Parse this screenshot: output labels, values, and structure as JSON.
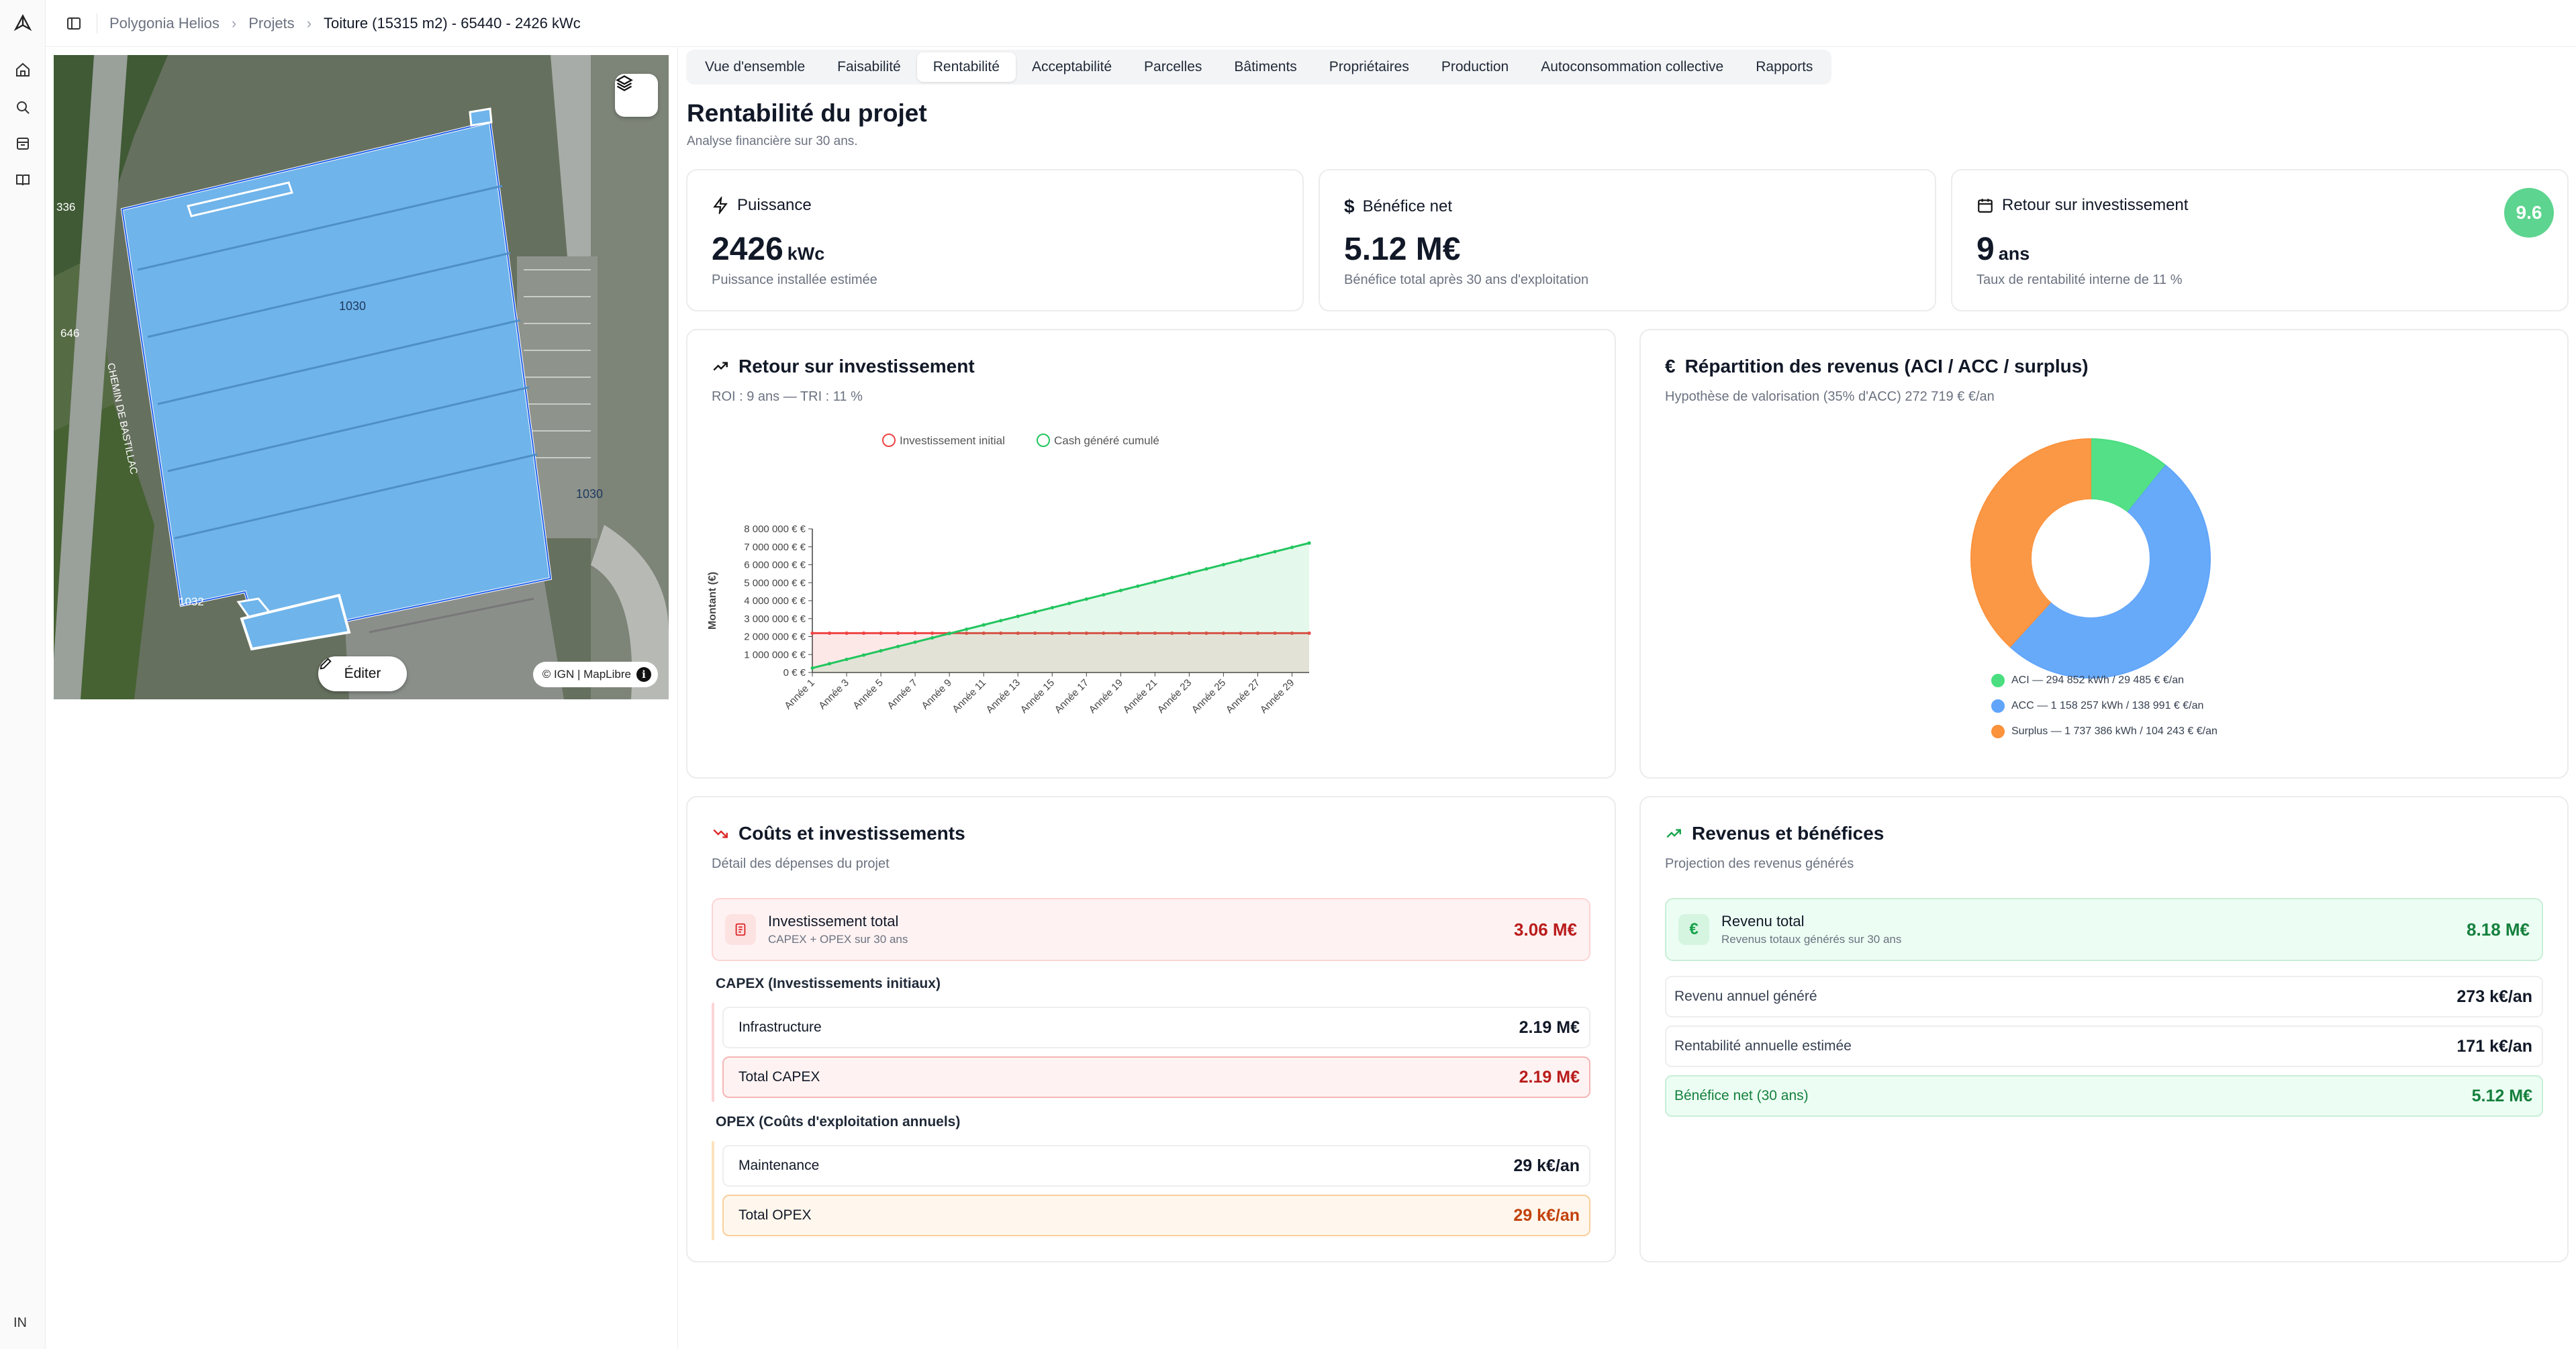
{
  "rail": {
    "user_initials": "IN"
  },
  "breadcrumb": [
    "Polygonia Helios",
    "Projets",
    "Toiture (15315 m2) - 65440 - 2426 kWc"
  ],
  "map": {
    "edit_label": "Éditer",
    "attribution": "© IGN | MapLibre",
    "labels": [
      "1030",
      "1030",
      "336",
      "646",
      "CHEMIN DE BASTILLAC",
      "1032"
    ]
  },
  "tabs": [
    {
      "label": "Vue d'ensemble",
      "active": false
    },
    {
      "label": "Faisabilité",
      "active": false
    },
    {
      "label": "Rentabilité",
      "active": true
    },
    {
      "label": "Acceptabilité",
      "active": false
    },
    {
      "label": "Parcelles",
      "active": false
    },
    {
      "label": "Bâtiments",
      "active": false
    },
    {
      "label": "Propriétaires",
      "active": false
    },
    {
      "label": "Production",
      "active": false
    },
    {
      "label": "Autoconsommation collective",
      "active": false
    },
    {
      "label": "Rapports",
      "active": false
    }
  ],
  "page": {
    "title": "Rentabilité du projet",
    "subtitle": "Analyse financière sur 30 ans."
  },
  "kpis": {
    "puissance": {
      "title": "Puissance",
      "value": "2426",
      "unit": "kWc",
      "desc": "Puissance installée estimée"
    },
    "benefice": {
      "title": "Bénéfice net",
      "value": "5.12 M€",
      "desc": "Bénéfice total après 30 ans d'exploitation"
    },
    "retour": {
      "title": "Retour sur investissement",
      "value": "9",
      "unit": "ans",
      "desc": "Taux de rentabilité interne de 11 %",
      "score": "9.6"
    }
  },
  "roi_card": {
    "title": "Retour sur investissement",
    "subtitle": "ROI : 9 ans — TRI : 11 %"
  },
  "revenue_card": {
    "title": "Répartition des revenus (ACI / ACC / surplus)",
    "subtitle": "Hypothèse de valorisation (35% d'ACC) 272 719 € €/an"
  },
  "chart_data": [
    {
      "type": "line",
      "ylabel": "Montant (€)",
      "ylim": [
        0,
        8000000
      ],
      "yticks": [
        "0 € €",
        "1 000 000 € €",
        "2 000 000 € €",
        "3 000 000 € €",
        "4 000 000 € €",
        "5 000 000 € €",
        "6 000 000 € €",
        "7 000 000 € €",
        "8 000 000 € €"
      ],
      "x": [
        1,
        2,
        3,
        4,
        5,
        6,
        7,
        8,
        9,
        10,
        11,
        12,
        13,
        14,
        15,
        16,
        17,
        18,
        19,
        20,
        21,
        22,
        23,
        24,
        25,
        26,
        27,
        28,
        29,
        30
      ],
      "xtick_labels": [
        "Année 1",
        "Année 3",
        "Année 5",
        "Année 7",
        "Année 9",
        "Année 11",
        "Année 13",
        "Année 15",
        "Année 17",
        "Année 19",
        "Année 21",
        "Année 23",
        "Année 25",
        "Année 27",
        "Année 29"
      ],
      "series": [
        {
          "name": "Investissement initial",
          "color": "#ef4444",
          "values": [
            2190000,
            2190000,
            2190000,
            2190000,
            2190000,
            2190000,
            2190000,
            2190000,
            2190000,
            2190000,
            2190000,
            2190000,
            2190000,
            2190000,
            2190000,
            2190000,
            2190000,
            2190000,
            2190000,
            2190000,
            2190000,
            2190000,
            2190000,
            2190000,
            2190000,
            2190000,
            2190000,
            2190000,
            2190000,
            2190000
          ]
        },
        {
          "name": "Cash généré cumulé",
          "color": "#22c55e",
          "values": [
            250000,
            490000,
            730000,
            970000,
            1210000,
            1450000,
            1690000,
            1930000,
            2170000,
            2410000,
            2650000,
            2890000,
            3130000,
            3370000,
            3610000,
            3850000,
            4090000,
            4330000,
            4570000,
            4810000,
            5050000,
            5290000,
            5530000,
            5770000,
            6010000,
            6250000,
            6490000,
            6730000,
            6970000,
            7210000
          ]
        }
      ],
      "legend": "top",
      "grid": false
    },
    {
      "type": "pie",
      "donut": true,
      "slices": [
        {
          "name": "ACI",
          "label": "ACI — 294 852 kWh / 29 485 € €/an",
          "value": 29485,
          "color": "#4ade80"
        },
        {
          "name": "ACC",
          "label": "ACC — 1 158 257 kWh / 138 991 € €/an",
          "value": 138991,
          "color": "#60a5fa"
        },
        {
          "name": "Surplus",
          "label": "Surplus — 1 737 386 kWh / 104 243 € €/an",
          "value": 104243,
          "color": "#fb923c"
        }
      ],
      "legend": "bottom"
    }
  ],
  "costs": {
    "title": "Coûts et investissements",
    "subtitle": "Détail des dépenses du projet",
    "total": {
      "label": "Investissement total",
      "sub": "CAPEX + OPEX sur 30 ans",
      "value": "3.06 M€"
    },
    "capex_label": "CAPEX (Investissements initiaux)",
    "capex_rows": [
      {
        "label": "Infrastructure",
        "value": "2.19 M€"
      }
    ],
    "capex_total": {
      "label": "Total CAPEX",
      "value": "2.19 M€"
    },
    "opex_label": "OPEX (Coûts d'exploitation annuels)",
    "opex_rows": [
      {
        "label": "Maintenance",
        "value": "29 k€/an"
      }
    ],
    "opex_total": {
      "label": "Total OPEX",
      "value": "29 k€/an"
    }
  },
  "revenues": {
    "title": "Revenus et bénéfices",
    "subtitle": "Projection des revenus générés",
    "total": {
      "label": "Revenu total",
      "sub": "Revenus totaux générés sur 30 ans",
      "value": "8.18 M€"
    },
    "rows": [
      {
        "label": "Revenu annuel généré",
        "value": "273 k€/an"
      },
      {
        "label": "Rentabilité annuelle estimée",
        "value": "171 k€/an"
      }
    ],
    "net": {
      "label": "Bénéfice net (30 ans)",
      "value": "5.12 M€"
    }
  },
  "colors": {
    "green": "#22c55e",
    "red": "#ef4444",
    "roof": "#6fb4ea"
  }
}
